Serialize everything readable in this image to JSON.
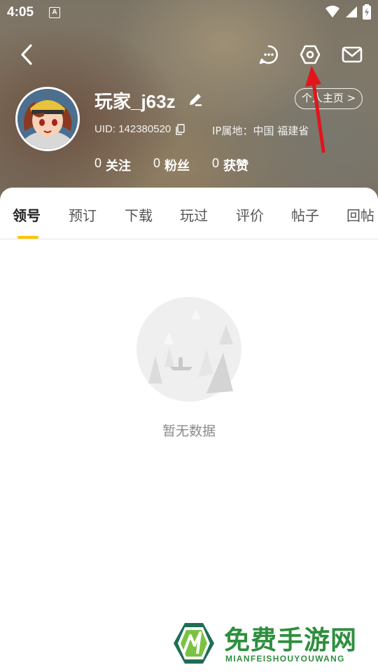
{
  "status_bar": {
    "time": "4:05",
    "notification_glyph": "A",
    "icons": [
      "wifi-icon",
      "signal-icon",
      "battery-icon"
    ]
  },
  "toolbar": {
    "back_icon": "back-arrow-icon",
    "chat_icon": "chat-bubble-icon",
    "settings_icon": "settings-hexagon-icon",
    "mail_icon": "mail-icon"
  },
  "profile": {
    "username": "玩家_j63z",
    "uid": "UID: 142380520",
    "ip_location": "IP属地：中国 福建省",
    "home_link": "个人主页 >",
    "stats": [
      {
        "value": "0",
        "label": "关注"
      },
      {
        "value": "0",
        "label": "粉丝"
      },
      {
        "value": "0",
        "label": "获赞"
      }
    ]
  },
  "tabs": [
    {
      "label": "领号",
      "active": true
    },
    {
      "label": "预订",
      "active": false
    },
    {
      "label": "下载",
      "active": false
    },
    {
      "label": "玩过",
      "active": false
    },
    {
      "label": "评价",
      "active": false
    },
    {
      "label": "帖子",
      "active": false
    },
    {
      "label": "回帖",
      "active": false
    }
  ],
  "empty_state": {
    "text": "暂无数据"
  },
  "watermark": {
    "title": "免费手游网",
    "subtitle": "MIANFEISHOUYOUWANG"
  },
  "colors": {
    "accent": "#ffc300",
    "annotation": "#e0161c",
    "watermark_green": "#2e8f3e"
  }
}
